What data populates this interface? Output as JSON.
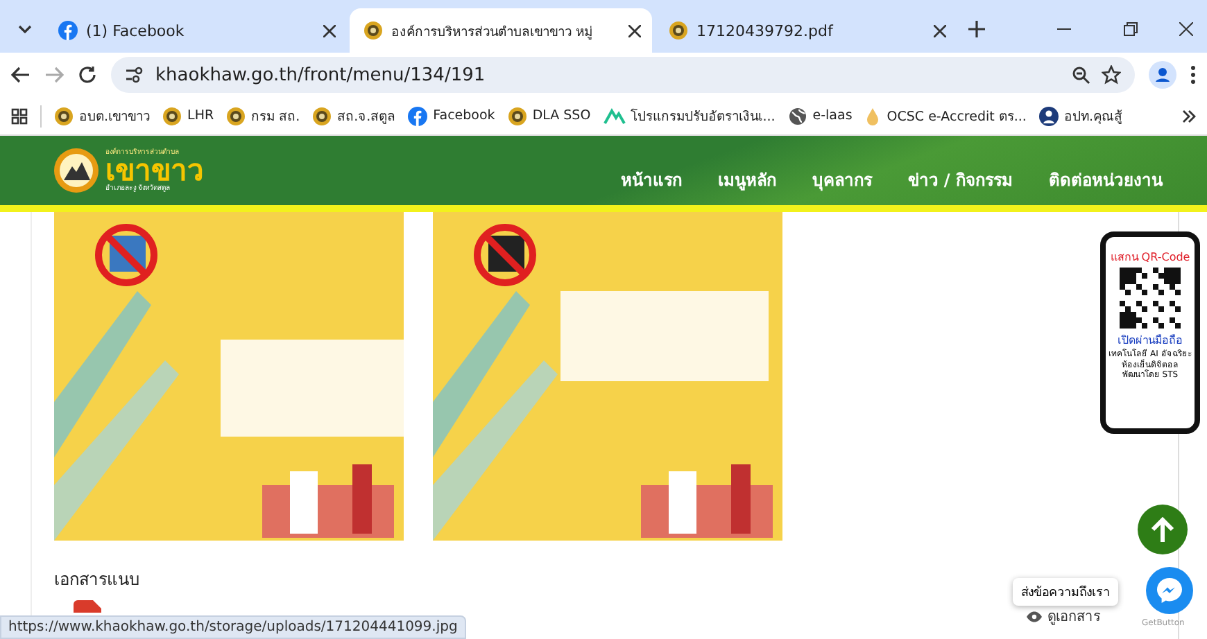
{
  "browser": {
    "tabs": [
      {
        "title": "(1) Facebook",
        "selected": false
      },
      {
        "title": "องค์การบริหารส่วนตำบลเขาขาว หมู่",
        "selected": true
      },
      {
        "title": "17120439792.pdf",
        "selected": false
      }
    ],
    "url": "khaokhaw.go.th/front/menu/134/191",
    "bookmarks": [
      {
        "label": "อบต.เขาขาว"
      },
      {
        "label": "LHR"
      },
      {
        "label": "กรม สถ."
      },
      {
        "label": "สถ.จ.สตูล"
      },
      {
        "label": "Facebook"
      },
      {
        "label": "DLA SSO"
      },
      {
        "label": "โปรแกรมปรับอัตราเงินเ..."
      },
      {
        "label": "e-laas"
      },
      {
        "label": "OCSC e-Accredit ตร..."
      },
      {
        "label": "อปท.คุณสู้"
      }
    ]
  },
  "site": {
    "logo_top": "องค์การบริหารส่วนตำบล",
    "logo_text": "เขาขาว",
    "logo_sub": "อำเภอละงู จังหวัดสตูล",
    "nav": [
      {
        "label": "หน้าแรก"
      },
      {
        "label": "เมนูหลัก"
      },
      {
        "label": "บุคลากร"
      },
      {
        "label": "ข่าว / กิจกรรม"
      },
      {
        "label": "ติดต่อหน่วยงาน"
      }
    ]
  },
  "content": {
    "attachments_heading": "เอกสารแนบ",
    "view_link": "ดูเอกสาร"
  },
  "qr_card": {
    "title": "แสกน QR-Code",
    "subtitle": "เปิดผ่านมือถือ",
    "line1": "เทคโนโลยี AI อัจฉริยะ",
    "line2": "ห้องเย็นดิจิตอล",
    "credit": "พัฒนาโดย STS"
  },
  "chat": {
    "tooltip": "ส่งข้อความถึงเรา",
    "brand": "GetButton"
  },
  "status_url": "https://www.khaokhaw.go.th/storage/uploads/171204441099.jpg"
}
